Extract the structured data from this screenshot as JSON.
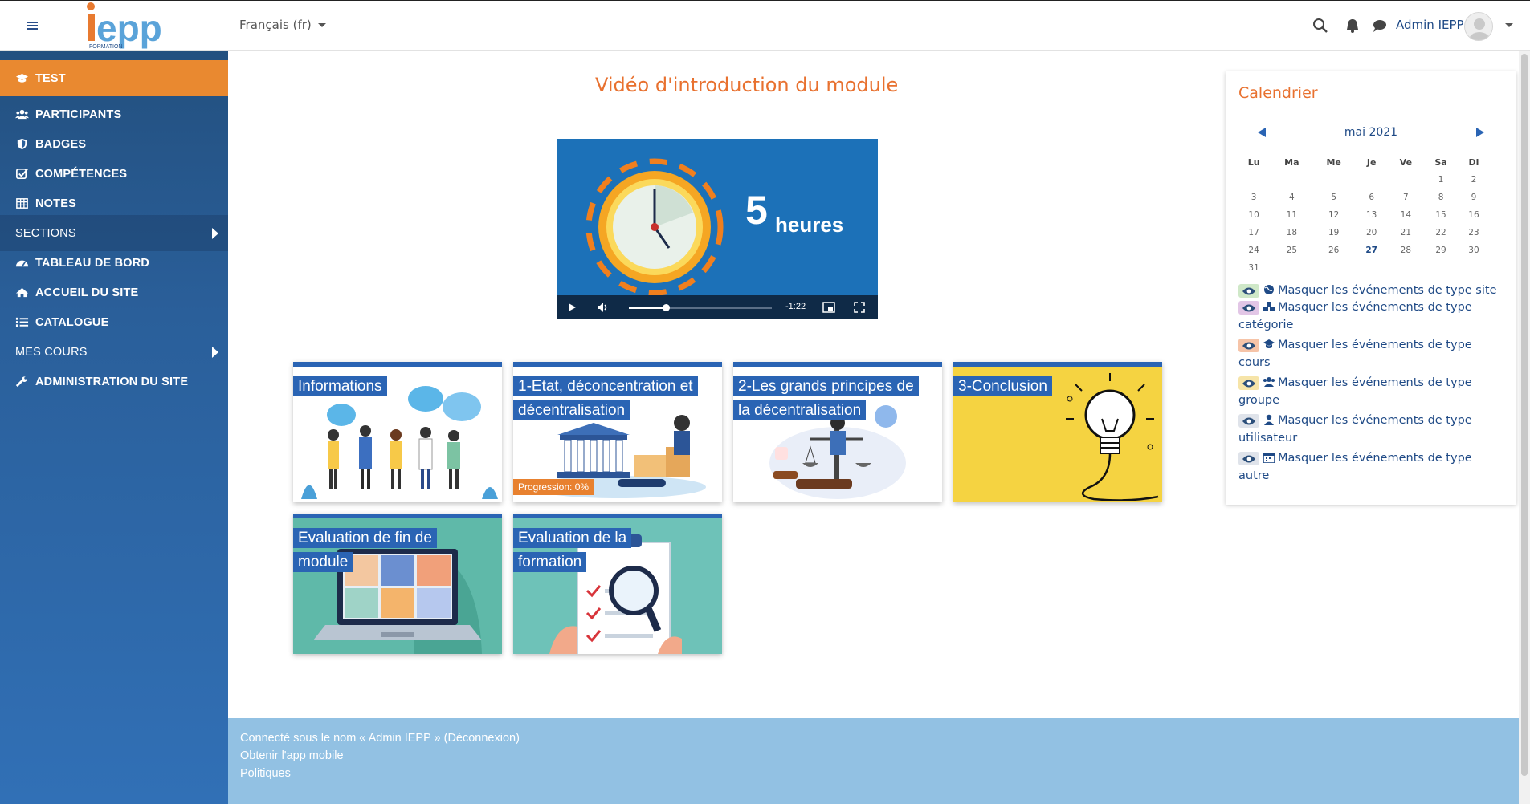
{
  "navbar": {
    "menu_icon": "hamburger-icon",
    "logo": {
      "mark": "iepp",
      "subtitle": "FORMATION",
      "colors": {
        "i": "#e87a30",
        "epp": "#5aa3d9"
      }
    },
    "language": "Français (fr)",
    "icons": [
      "search-icon",
      "bell-icon",
      "chat-icon"
    ],
    "user_name": "Admin IEPP"
  },
  "sidebar": {
    "items": [
      {
        "label": "TEST",
        "icon": "graduation-cap-icon",
        "active": true
      },
      {
        "label": "PARTICIPANTS",
        "icon": "users-icon"
      },
      {
        "label": "BADGES",
        "icon": "shield-icon"
      },
      {
        "label": "COMPÉTENCES",
        "icon": "check-square-icon"
      },
      {
        "label": "NOTES",
        "icon": "table-icon"
      },
      {
        "label": "SECTIONS",
        "expandable": true
      },
      {
        "label": "TABLEAU DE BORD",
        "icon": "dashboard-icon"
      },
      {
        "label": "ACCUEIL DU SITE",
        "icon": "home-icon"
      },
      {
        "label": "CATALOGUE",
        "icon": "list-icon"
      },
      {
        "label": "MES COURS",
        "expandable": true
      },
      {
        "label": "ADMINISTRATION DU SITE",
        "icon": "wrench-icon"
      }
    ]
  },
  "main": {
    "video_title": "Vidéo d'introduction du module",
    "video": {
      "big_number": "5",
      "unit": "heures",
      "time_remaining": "-1:22",
      "progress": 0.26
    },
    "tiles": [
      {
        "lines": [
          "Informations"
        ],
        "image": "people-speech-bubbles"
      },
      {
        "lines": [
          "1-Etat, déconcentration et",
          "décentralisation"
        ],
        "image": "state-buildings",
        "progress": "Progression: 0%"
      },
      {
        "lines": [
          "2-Les grands principes de",
          "la décentralisation"
        ],
        "image": "justice-scales"
      },
      {
        "lines": [
          "3-Conclusion"
        ],
        "image": "lightbulb"
      },
      {
        "lines": [
          "Evaluation de fin de",
          "module"
        ],
        "image": "laptop-video-call"
      },
      {
        "lines": [
          "Evaluation de la",
          "formation"
        ],
        "image": "checklist-magnifier"
      }
    ]
  },
  "calendar": {
    "title": "Calendrier",
    "month": "mai 2021",
    "weekdays": [
      "Lu",
      "Ma",
      "Me",
      "Je",
      "Ve",
      "Sa",
      "Di"
    ],
    "weeks": [
      [
        "",
        "",
        "",
        "",
        "",
        "1",
        "2"
      ],
      [
        "3",
        "4",
        "5",
        "6",
        "7",
        "8",
        "9"
      ],
      [
        "10",
        "11",
        "12",
        "13",
        "14",
        "15",
        "16"
      ],
      [
        "17",
        "18",
        "19",
        "20",
        "21",
        "22",
        "23"
      ],
      [
        "24",
        "25",
        "26",
        "27",
        "28",
        "29",
        "30"
      ],
      [
        "31",
        "",
        "",
        "",
        "",
        "",
        ""
      ]
    ],
    "today": "27",
    "filters": [
      {
        "lines": [
          "Masquer les événements de type site"
        ],
        "icon": "globe-icon",
        "color": "#cfe8c8"
      },
      {
        "lines": [
          "Masquer les événements de type",
          "catégorie"
        ],
        "icon": "cubes-icon",
        "color": "#e2c6e6"
      },
      {
        "lines": [
          "Masquer les événements de type",
          "cours"
        ],
        "icon": "graduation-cap-icon",
        "color": "#f6c4a8"
      },
      {
        "lines": [
          "Masquer les événements de type",
          "groupe"
        ],
        "icon": "users-icon",
        "color": "#f6e4a8"
      },
      {
        "lines": [
          "Masquer les événements de type",
          "utilisateur"
        ],
        "icon": "user-icon",
        "color": "#dfe3ea"
      },
      {
        "lines": [
          "Masquer les événements de type",
          "autre"
        ],
        "icon": "calendar-icon",
        "color": "#dfe3ea"
      }
    ]
  },
  "footer": {
    "logged_in": "Connecté sous le nom « Admin IEPP » (Déconnexion)",
    "mobile_app": "Obtenir l'app mobile",
    "policies": "Politiques"
  }
}
